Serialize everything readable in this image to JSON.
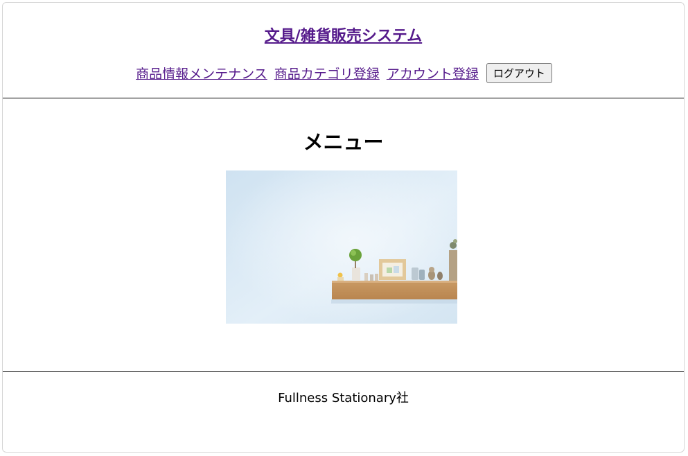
{
  "header": {
    "site_title": "文具/雑貨販売システム",
    "nav": [
      {
        "label": "商品情報メンテナンス"
      },
      {
        "label": "商品カテゴリ登録"
      },
      {
        "label": "アカウント登録"
      }
    ],
    "logout_label": "ログアウト"
  },
  "main": {
    "heading": "メニュー"
  },
  "footer": {
    "company": "Fullness Stationary社"
  },
  "colors": {
    "link": "#551a8b",
    "divider": "#000000"
  }
}
